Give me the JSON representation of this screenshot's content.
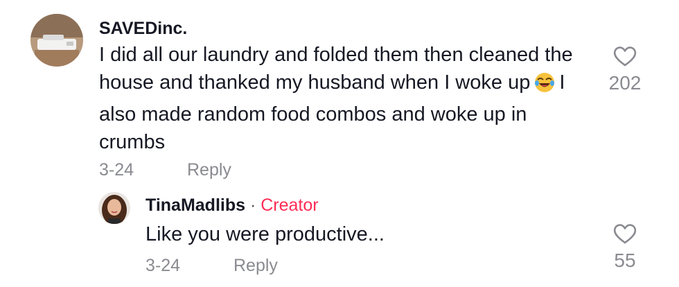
{
  "comments": [
    {
      "username": "SAVEDinc.",
      "text_before_emoji": "I did all our laundry and folded them then cleaned the house and thanked my husband when I woke up",
      "emoji": "laughing-crying-emoji",
      "text_after_emoji": "I also made random food combos and woke up in crumbs",
      "date": "3-24",
      "reply_label": "Reply",
      "like_count": "202"
    }
  ],
  "replies": [
    {
      "username": "TinaMadlibs",
      "separator": " · ",
      "badge": "Creator",
      "text": "Like you were productive...",
      "date": "3-24",
      "reply_label": "Reply",
      "like_count": "55"
    }
  ],
  "colors": {
    "creator_badge": "#fe2c55",
    "meta_text": "#8a8b91",
    "primary_text": "#161823"
  },
  "icons": [
    "heart-outline-icon",
    "laughing-crying-emoji"
  ]
}
